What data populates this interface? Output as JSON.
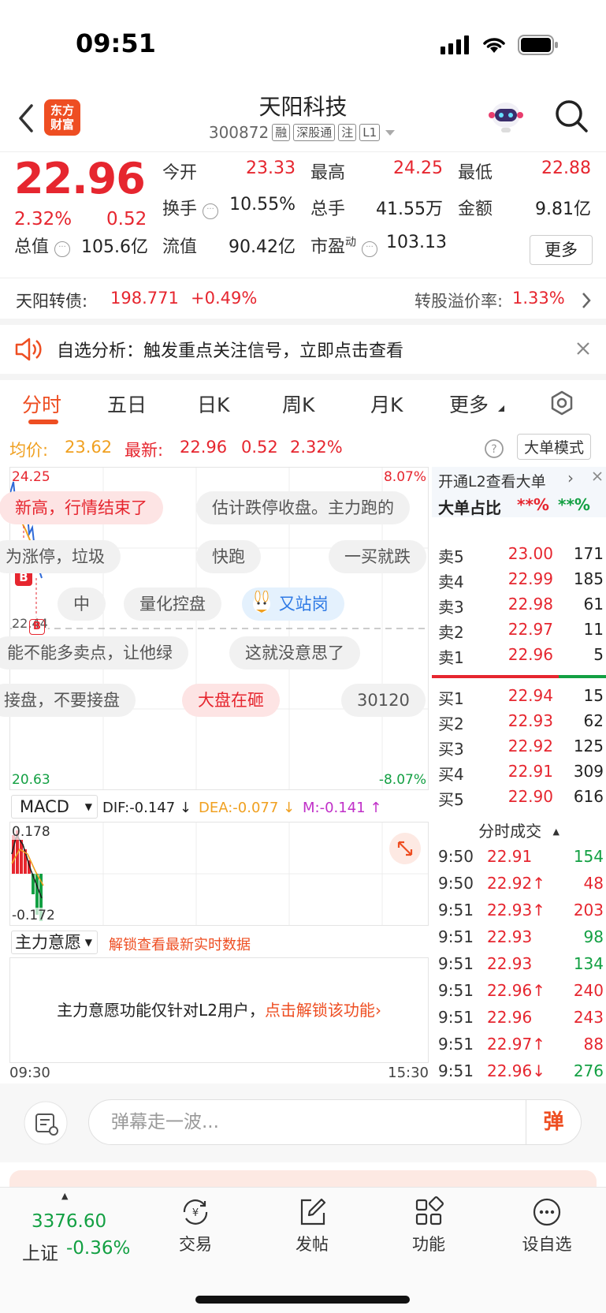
{
  "status_bar": {
    "time": "09:51"
  },
  "header": {
    "brand_line1": "东方",
    "brand_line2": "财富",
    "stock_name": "天阳科技",
    "stock_code": "300872",
    "tags": [
      "融",
      "深股通",
      "注",
      "L1"
    ]
  },
  "quote": {
    "last_price": "22.96",
    "change_pct": "2.32%",
    "change_amt": "0.52",
    "open_label": "今开",
    "open": "23.33",
    "high_label": "最高",
    "high": "24.25",
    "low_label": "最低",
    "low": "22.88",
    "turnover_label": "换手",
    "turnover": "10.55%",
    "volume_label": "总手",
    "volume": "41.55万",
    "amount_label": "金额",
    "amount": "9.81亿",
    "mktcap_label": "总值",
    "mktcap": "105.6亿",
    "float_label": "流值",
    "float_cap": "90.42亿",
    "pe_label": "市盈",
    "pe_sup": "动",
    "pe": "103.13",
    "more_label": "更多"
  },
  "convertible": {
    "label": "天阳转债:",
    "price": "198.771",
    "change": "+0.49%",
    "premium_label": "转股溢价率:",
    "premium": "1.33%"
  },
  "notice": {
    "text": "自选分析：触发重点关注信号，立即点击查看"
  },
  "tabs": [
    "分时",
    "五日",
    "日K",
    "周K",
    "月K",
    "更多"
  ],
  "avg_row": {
    "avg_label": "均价:",
    "avg": "23.62",
    "latest_label": "最新:",
    "latest": "22.96",
    "chg": "0.52",
    "pct": "2.32%",
    "mode_label": "大单模式"
  },
  "chart": {
    "top_price": "24.25",
    "bottom_price": "20.63",
    "top_pct": "8.07%",
    "bottom_pct": "-8.07%",
    "ref_price": "22.44",
    "buy_marker": "B",
    "sell_marker": "B",
    "danmu": {
      "row1": [
        "新高，行情结束了",
        "估计跌停收盘。主力跑的"
      ],
      "row2": [
        "为涨停，垃圾",
        "快跑",
        "一买就跌"
      ],
      "row3": [
        "中",
        "量化控盘",
        "又站岗"
      ],
      "row4": [
        "能不能多卖点，让他绿",
        "这就没意思了"
      ],
      "row5": [
        "接盘，不要接盘",
        "大盘在砸",
        "30120"
      ]
    }
  },
  "macd": {
    "label": "MACD",
    "dif": "DIF:-0.147 ↓",
    "dea": "DEA:-0.077 ↓",
    "m": "M:-0.141 ↑",
    "top": "0.178",
    "bottom": "-0.172"
  },
  "zl": {
    "label": "主力意愿",
    "unlock_hint": "解锁查看最新实时数据",
    "msg": "主力意愿功能仅针对L2用户，",
    "link": "点击解锁该功能"
  },
  "time_axis": {
    "start": "09:30",
    "end": "15:30"
  },
  "book": {
    "l2_link": "开通L2查看大单",
    "big_ratio_label": "大单占比",
    "big_ratio_a": "**%",
    "big_ratio_b": "**%",
    "asks": [
      {
        "label": "卖5",
        "price": "23.00",
        "vol": "171"
      },
      {
        "label": "卖4",
        "price": "22.99",
        "vol": "185"
      },
      {
        "label": "卖3",
        "price": "22.98",
        "vol": "61"
      },
      {
        "label": "卖2",
        "price": "22.97",
        "vol": "11"
      },
      {
        "label": "卖1",
        "price": "22.96",
        "vol": "5"
      }
    ],
    "bids": [
      {
        "label": "买1",
        "price": "22.94",
        "vol": "15"
      },
      {
        "label": "买2",
        "price": "22.93",
        "vol": "62"
      },
      {
        "label": "买3",
        "price": "22.92",
        "vol": "125"
      },
      {
        "label": "买4",
        "price": "22.91",
        "vol": "309"
      },
      {
        "label": "买5",
        "price": "22.90",
        "vol": "616"
      }
    ],
    "ticks_title": "分时成交",
    "ticks": [
      {
        "t": "9:50",
        "px": "22.91",
        "vol": "154",
        "side": "buy"
      },
      {
        "t": "9:50",
        "px": "22.92↑",
        "vol": "48",
        "side": "sell"
      },
      {
        "t": "9:51",
        "px": "22.93↑",
        "vol": "203",
        "side": "sell"
      },
      {
        "t": "9:51",
        "px": "22.93",
        "vol": "98",
        "side": "buy"
      },
      {
        "t": "9:51",
        "px": "22.93",
        "vol": "134",
        "side": "buy"
      },
      {
        "t": "9:51",
        "px": "22.96↑",
        "vol": "240",
        "side": "sell"
      },
      {
        "t": "9:51",
        "px": "22.96",
        "vol": "243",
        "side": "sell"
      },
      {
        "t": "9:51",
        "px": "22.97↑",
        "vol": "88",
        "side": "sell"
      },
      {
        "t": "9:51",
        "px": "22.96↓",
        "vol": "276",
        "side": "buy"
      }
    ]
  },
  "comment_bar": {
    "placeholder": "弹幕走一波...",
    "danmu_btn": "弹"
  },
  "bottom_nav": {
    "index_value": "3376.60",
    "index_name": "上证",
    "index_change": "-0.36%",
    "items": [
      "交易",
      "发帖",
      "功能",
      "设自选"
    ]
  },
  "colors": {
    "up": "#e6262f",
    "down": "#13a043",
    "accent": "#ee4e22"
  }
}
